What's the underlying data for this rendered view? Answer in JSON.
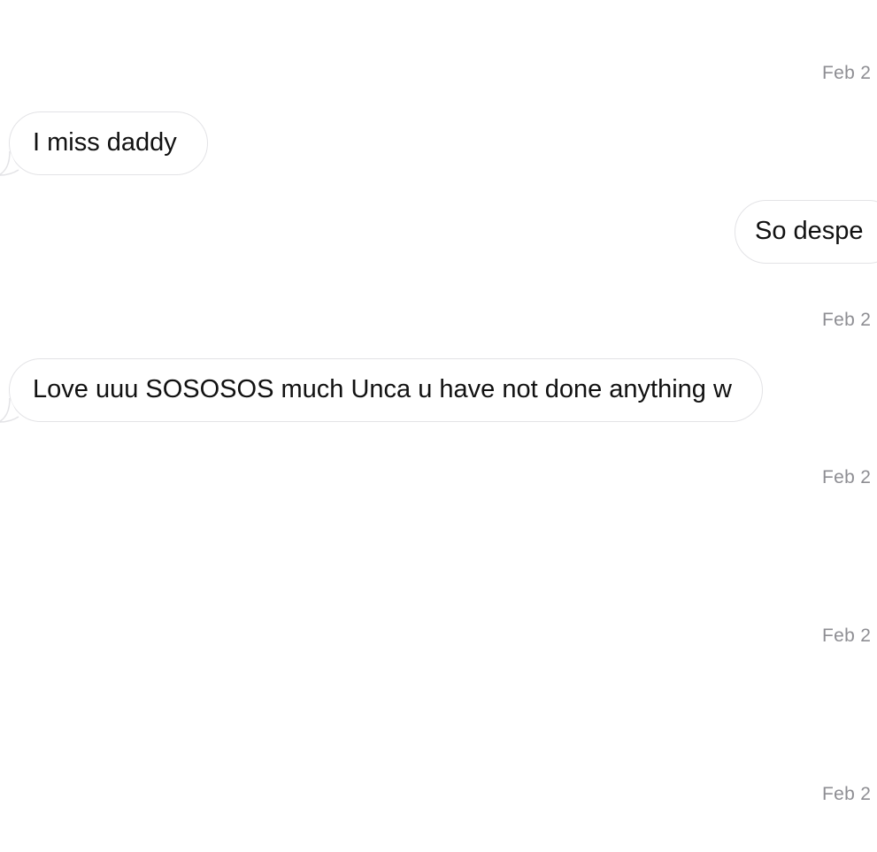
{
  "conversation": {
    "messages": [
      {
        "type": "timestamp",
        "text": "Feb 2"
      },
      {
        "type": "incoming",
        "text": "I miss daddy"
      },
      {
        "type": "outgoing",
        "text": "So despe"
      },
      {
        "type": "timestamp",
        "text": "Feb 2"
      },
      {
        "type": "incoming",
        "text": "Love uuu SOSOSOS much Unca u have not done anything w"
      },
      {
        "type": "timestamp",
        "text": "Feb 2"
      },
      {
        "type": "timestamp",
        "text": "Feb 2"
      },
      {
        "type": "timestamp",
        "text": "Feb 2"
      }
    ]
  }
}
